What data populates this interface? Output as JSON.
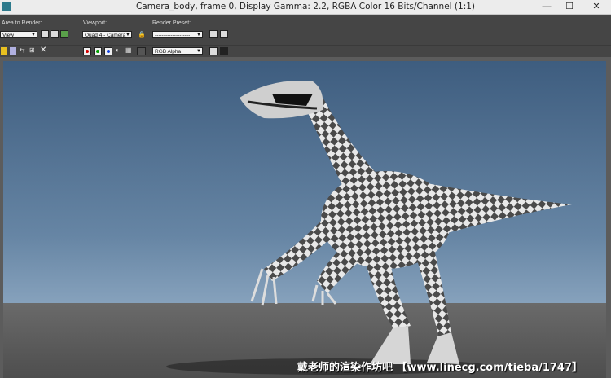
{
  "window": {
    "title": "Camera_body, frame 0, Display Gamma: 2.2, RGBA Color 16 Bits/Channel (1:1)",
    "minimize_glyph": "—",
    "maximize_glyph": "☐",
    "close_glyph": "✕"
  },
  "toolbar": {
    "area_label": "Area to Render:",
    "area_value": "View",
    "viewport_label": "Viewport:",
    "viewport_value": "Quad 4 - Camera_",
    "preset_label": "Render Preset:",
    "preset_value": "--------------------",
    "channel_value": "RGB Alpha"
  },
  "colors": {
    "red_channel": "#d40000",
    "green_channel": "#00a000",
    "blue_channel": "#1040e0"
  },
  "watermark": "戴老师的渲染作坊吧 【www.linecg.com/tieba/1747】"
}
